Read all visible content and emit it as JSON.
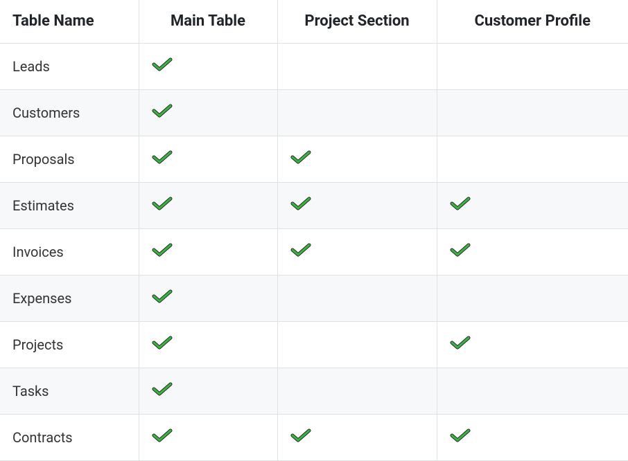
{
  "table": {
    "headers": [
      "Table Name",
      "Main Table",
      "Project Section",
      "Customer Profile"
    ],
    "rows": [
      {
        "name": "Leads",
        "main_table": true,
        "project_section": false,
        "customer_profile": false
      },
      {
        "name": "Customers",
        "main_table": true,
        "project_section": false,
        "customer_profile": false
      },
      {
        "name": "Proposals",
        "main_table": true,
        "project_section": true,
        "customer_profile": false
      },
      {
        "name": "Estimates",
        "main_table": true,
        "project_section": true,
        "customer_profile": true
      },
      {
        "name": "Invoices",
        "main_table": true,
        "project_section": true,
        "customer_profile": true
      },
      {
        "name": "Expenses",
        "main_table": true,
        "project_section": false,
        "customer_profile": false
      },
      {
        "name": "Projects",
        "main_table": true,
        "project_section": false,
        "customer_profile": true
      },
      {
        "name": "Tasks",
        "main_table": true,
        "project_section": false,
        "customer_profile": false
      },
      {
        "name": "Contracts",
        "main_table": true,
        "project_section": true,
        "customer_profile": true
      }
    ]
  },
  "icons": {
    "check_color": "#3cb043",
    "check_stroke": "#1a1a1a"
  }
}
